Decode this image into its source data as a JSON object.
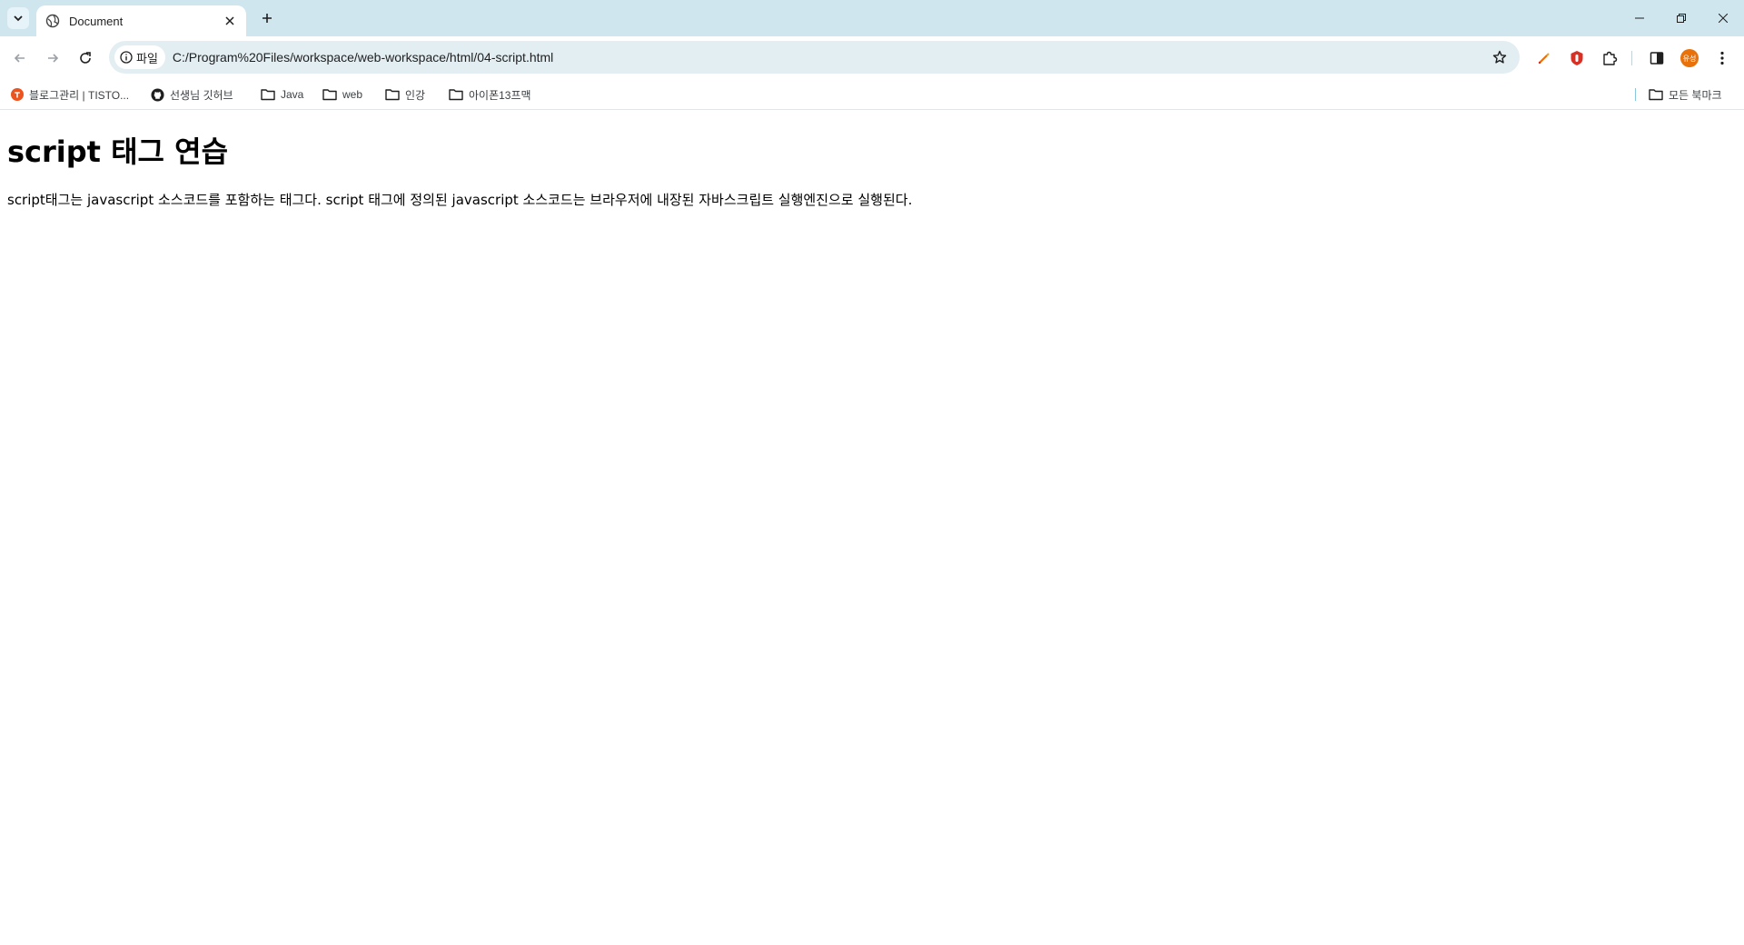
{
  "browser": {
    "tab": {
      "title": "Document"
    },
    "omnibox": {
      "chip_label": "파일",
      "url": "C:/Program%20Files/workspace/web-workspace/html/04-script.html"
    },
    "profile_initials": "유성",
    "bookmarks": [
      {
        "label": "블로그관리 | TISTO...",
        "icon": "tistory-icon"
      },
      {
        "label": "선생님 깃허브",
        "icon": "github-icon"
      },
      {
        "label": "Java",
        "icon": "folder-icon"
      },
      {
        "label": "web",
        "icon": "folder-icon"
      },
      {
        "label": "인강",
        "icon": "folder-icon"
      },
      {
        "label": "아이폰13프맥",
        "icon": "folder-icon"
      }
    ],
    "all_bookmarks_label": "모든 북마크",
    "colors": {
      "tab_strip": "#cfe6ee",
      "omnibox": "#e3eef3",
      "tistory": "#eb531f",
      "avatar": "#e8710a"
    }
  },
  "page": {
    "heading": "script 태그 연습",
    "paragraph": "script태그는 javascript 소스코드를 포함하는 태그다. script 태그에 정의된 javascript 소스코드는 브라우저에 내장된 자바스크립트 실행엔진으로 실행된다."
  }
}
